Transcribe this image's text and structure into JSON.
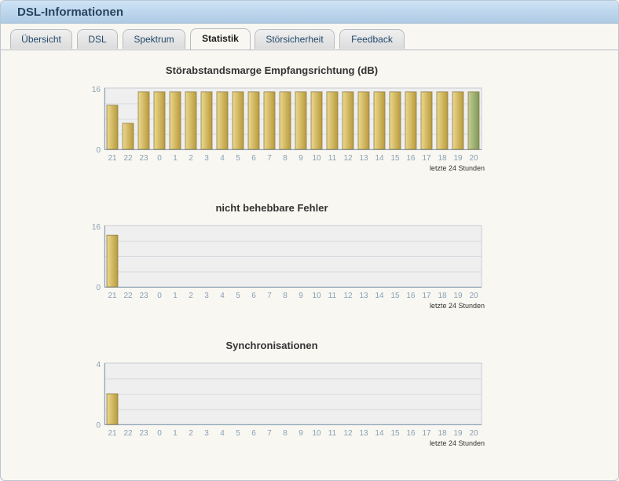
{
  "window": {
    "title": "DSL-Informationen"
  },
  "tabs": [
    {
      "label": "Übersicht",
      "active": false
    },
    {
      "label": "DSL",
      "active": false
    },
    {
      "label": "Spektrum",
      "active": false
    },
    {
      "label": "Statistik",
      "active": true
    },
    {
      "label": "Störsicherheit",
      "active": false
    },
    {
      "label": "Feedback",
      "active": false
    }
  ],
  "colors": {
    "bar_gold": "#d9c06a",
    "bar_green": "#9eae72",
    "plot_bg": "#efefef",
    "tick_text": "#8aa0b4"
  },
  "chart_data": [
    {
      "type": "bar",
      "title": "Störabstandsmarge Empfangsrichtung (dB)",
      "footer": "letzte 24 Stunden",
      "categories": [
        "21",
        "22",
        "23",
        "0",
        "1",
        "2",
        "3",
        "4",
        "5",
        "6",
        "7",
        "8",
        "9",
        "10",
        "11",
        "12",
        "13",
        "14",
        "15",
        "16",
        "17",
        "18",
        "19",
        "20"
      ],
      "values": [
        11.5,
        6.8,
        15,
        15,
        15,
        15,
        15,
        15,
        15,
        15,
        15,
        15,
        15,
        15,
        15,
        15,
        15,
        15,
        15,
        15,
        15,
        15,
        15,
        15
      ],
      "highlight_last": true,
      "ylim": [
        0,
        16
      ],
      "yticks": [
        "0",
        "16"
      ],
      "grid": true
    },
    {
      "type": "bar",
      "title": "nicht behebbare Fehler",
      "footer": "letzte 24 Stunden",
      "categories": [
        "21",
        "22",
        "23",
        "0",
        "1",
        "2",
        "3",
        "4",
        "5",
        "6",
        "7",
        "8",
        "9",
        "10",
        "11",
        "12",
        "13",
        "14",
        "15",
        "16",
        "17",
        "18",
        "19",
        "20"
      ],
      "values": [
        13.5,
        0,
        0,
        0,
        0,
        0,
        0,
        0,
        0,
        0,
        0,
        0,
        0,
        0,
        0,
        0,
        0,
        0,
        0,
        0,
        0,
        0,
        0,
        0
      ],
      "highlight_last": false,
      "ylim": [
        0,
        16
      ],
      "yticks": [
        "0",
        "16"
      ],
      "grid": true
    },
    {
      "type": "bar",
      "title": "Synchronisationen",
      "footer": "letzte 24 Stunden",
      "categories": [
        "21",
        "22",
        "23",
        "0",
        "1",
        "2",
        "3",
        "4",
        "5",
        "6",
        "7",
        "8",
        "9",
        "10",
        "11",
        "12",
        "13",
        "14",
        "15",
        "16",
        "17",
        "18",
        "19",
        "20"
      ],
      "values": [
        2,
        0,
        0,
        0,
        0,
        0,
        0,
        0,
        0,
        0,
        0,
        0,
        0,
        0,
        0,
        0,
        0,
        0,
        0,
        0,
        0,
        0,
        0,
        0
      ],
      "highlight_last": false,
      "ylim": [
        0,
        4
      ],
      "yticks": [
        "0",
        "4"
      ],
      "grid": true
    }
  ]
}
